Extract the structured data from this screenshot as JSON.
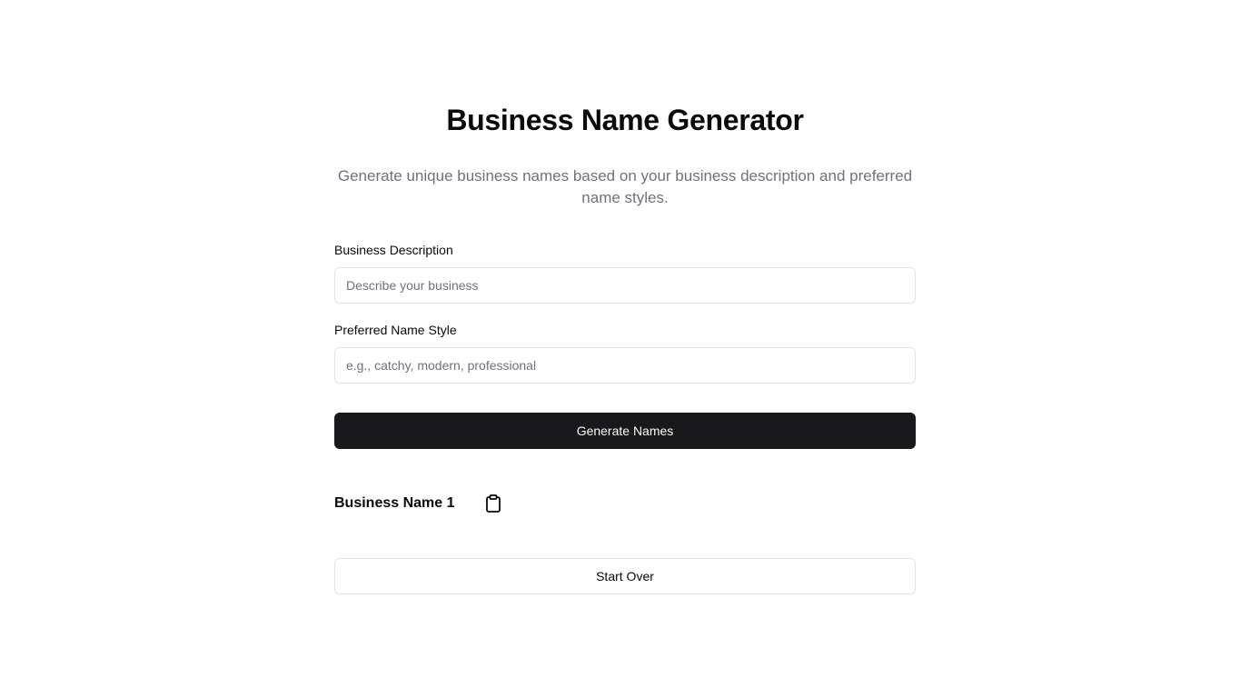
{
  "header": {
    "title": "Business Name Generator",
    "subtitle": "Generate unique business names based on your business description and preferred name styles."
  },
  "form": {
    "description_label": "Business Description",
    "description_placeholder": "Describe your business",
    "description_value": "",
    "style_label": "Preferred Name Style",
    "style_placeholder": "e.g., catchy, modern, professional",
    "style_value": "",
    "generate_label": "Generate Names"
  },
  "results": {
    "items": [
      {
        "name": "Business Name 1",
        "icon": "clipboard-icon"
      }
    ]
  },
  "actions": {
    "start_over_label": "Start Over"
  },
  "colors": {
    "primary": "#18181b",
    "muted_text": "#71717a",
    "border": "#e4e4e7"
  }
}
